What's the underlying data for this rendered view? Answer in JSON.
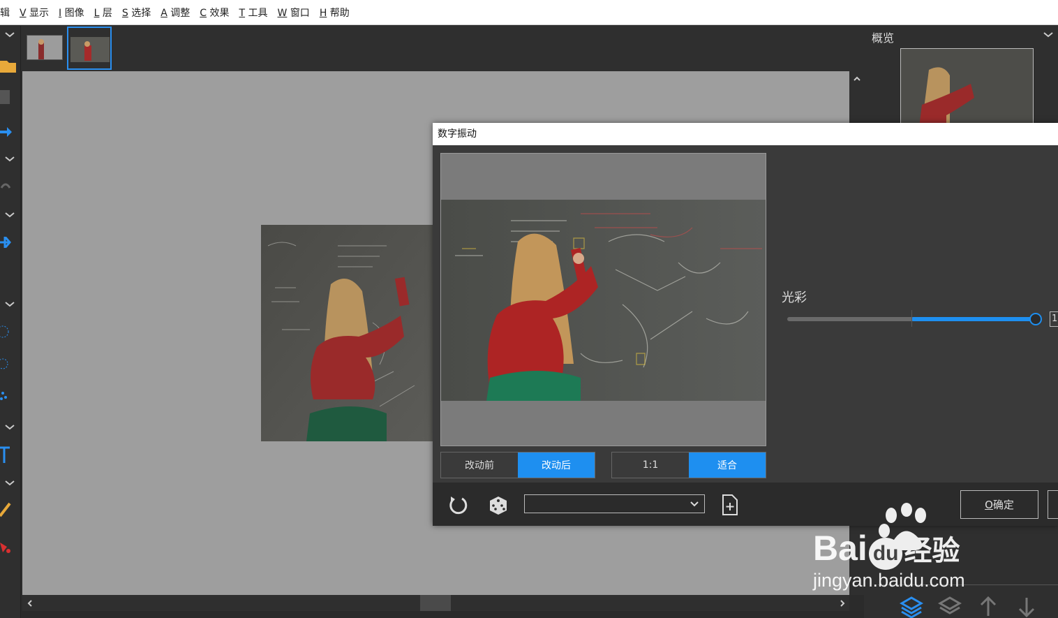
{
  "menu": [
    {
      "key": "",
      "label": "辑"
    },
    {
      "key": "V",
      "label": "显示"
    },
    {
      "key": "I",
      "label": "图像"
    },
    {
      "key": "L",
      "label": "层"
    },
    {
      "key": "S",
      "label": "选择"
    },
    {
      "key": "A",
      "label": "调整"
    },
    {
      "key": "C",
      "label": "效果"
    },
    {
      "key": "T",
      "label": "工具"
    },
    {
      "key": "W",
      "label": "窗口"
    },
    {
      "key": "H",
      "label": "帮助"
    }
  ],
  "overview": {
    "title": "概览"
  },
  "dialog": {
    "title": "数字振动",
    "compare": {
      "before": "改动前",
      "after": "改动后"
    },
    "zoom": {
      "actual": "1:1",
      "fit": "适合"
    },
    "slider": {
      "label": "光彩",
      "value_fraction": 1.0,
      "value_text": "1"
    },
    "preset_value": "",
    "ok_key": "O",
    "ok_label": "确定"
  },
  "watermark": {
    "brand_a": "Bai",
    "brand_b": "du",
    "brand_c": "经验",
    "url": "jingyan.baidu.com"
  },
  "colors": {
    "accent": "#1e8ff0",
    "panel": "#2f2f2f",
    "canvas": "#9e9e9e"
  }
}
